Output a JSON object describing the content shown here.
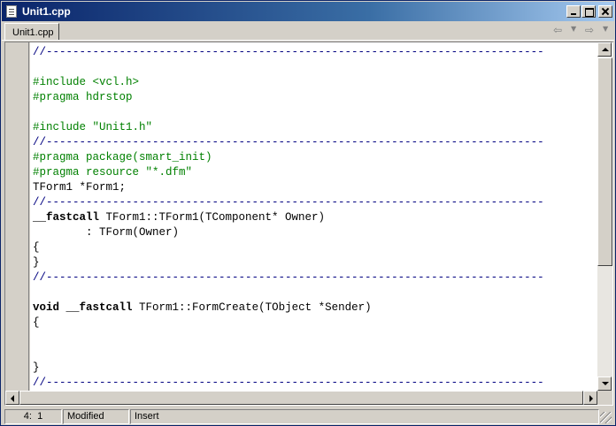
{
  "window": {
    "title": "Unit1.cpp"
  },
  "tabs": [
    {
      "label": "Unit1.cpp",
      "active": true
    }
  ],
  "nav": {
    "back_icon": "back-arrow-icon",
    "forward_icon": "forward-arrow-icon"
  },
  "editor": {
    "lines": [
      [
        {
          "t": "//---------------------------------------------------------------------------",
          "c": "comment"
        }
      ],
      [],
      [
        {
          "t": "#include <vcl.h>",
          "c": "pp"
        }
      ],
      [
        {
          "t": "#pragma hdrstop",
          "c": "pp"
        }
      ],
      [],
      [
        {
          "t": "#include \"Unit1.h\"",
          "c": "pp"
        }
      ],
      [
        {
          "t": "//---------------------------------------------------------------------------",
          "c": "comment"
        }
      ],
      [
        {
          "t": "#pragma package(smart_init)",
          "c": "pp"
        }
      ],
      [
        {
          "t": "#pragma resource \"*.dfm\"",
          "c": "pp"
        }
      ],
      [
        {
          "t": "TForm1 *Form1;",
          "c": "code"
        }
      ],
      [
        {
          "t": "//---------------------------------------------------------------------------",
          "c": "comment"
        }
      ],
      [
        {
          "t": "__fastcall",
          "c": "kw"
        },
        {
          "t": " TForm1::TForm1(TComponent* Owner)",
          "c": "code"
        }
      ],
      [
        {
          "t": "        : TForm(Owner)",
          "c": "code"
        }
      ],
      [
        {
          "t": "{",
          "c": "code"
        }
      ],
      [
        {
          "t": "}",
          "c": "code"
        }
      ],
      [
        {
          "t": "//---------------------------------------------------------------------------",
          "c": "comment"
        }
      ],
      [],
      [
        {
          "t": "void",
          "c": "kw"
        },
        {
          "t": " ",
          "c": "code"
        },
        {
          "t": "__fastcall",
          "c": "kw"
        },
        {
          "t": " TForm1::FormCreate(TObject *Sender)",
          "c": "code"
        }
      ],
      [
        {
          "t": "{",
          "c": "code"
        }
      ],
      [],
      [],
      [
        {
          "t": "}",
          "c": "code"
        }
      ],
      [
        {
          "t": "//---------------------------------------------------------------------------",
          "c": "comment"
        }
      ]
    ],
    "colors": {
      "comment": "#000080",
      "preprocessor": "#008000",
      "code": "#000000",
      "background": "#ffffff"
    }
  },
  "status": {
    "position": "4:  1",
    "modified": "Modified",
    "mode": "Insert"
  },
  "colors": {
    "titlebar_start": "#0a246a",
    "titlebar_end": "#a6caf0",
    "chrome": "#d4d0c8"
  }
}
